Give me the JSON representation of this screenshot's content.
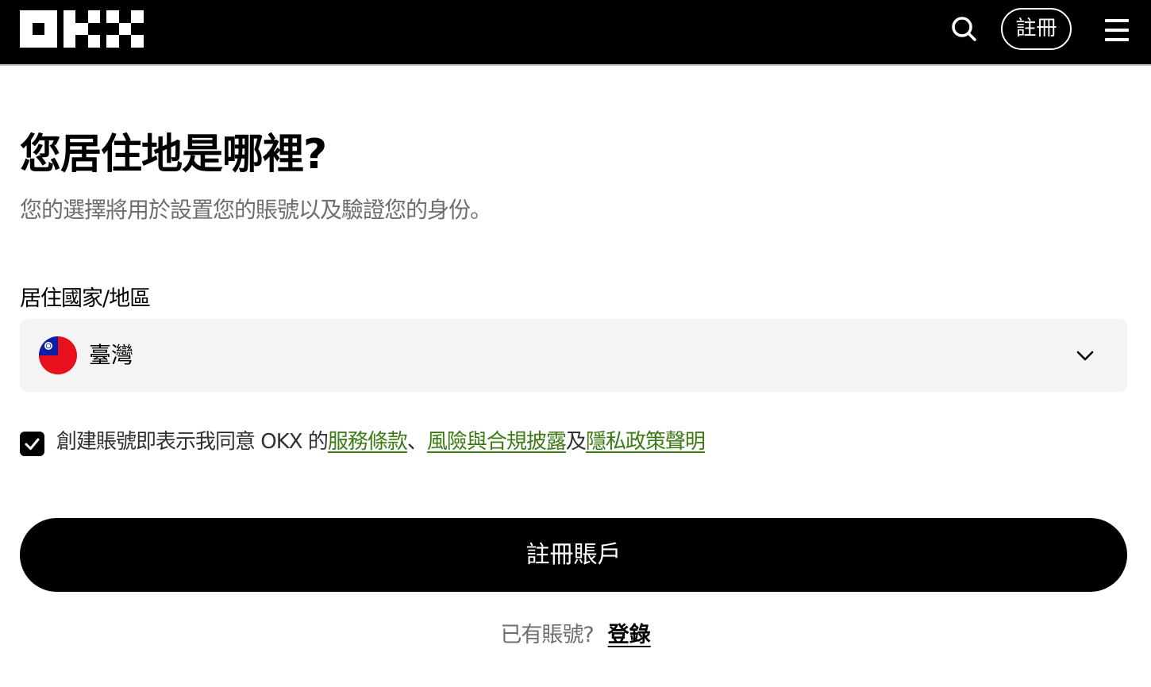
{
  "header": {
    "logo_text": "OKX",
    "search_icon": "search-icon",
    "signup_label": "註冊",
    "menu_icon": "hamburger-menu-icon"
  },
  "main": {
    "title": "您居住地是哪裡?",
    "subtitle": "您的選擇將用於設置您的賬號以及驗證您的身份。",
    "country_field": {
      "label": "居住國家/地區",
      "value": "臺灣",
      "flag_icon": "taiwan-flag-icon",
      "chevron_icon": "chevron-down-icon"
    },
    "agreement": {
      "checked": true,
      "prefix": "創建賬號即表示我同意 OKX 的",
      "terms_link": "服務條款",
      "separator": "、",
      "risk_link": "風險與合規披露",
      "conjunction": "及",
      "privacy_link": "隱私政策聲明"
    },
    "submit_label": "註冊賬戶",
    "login_prompt": "已有賬號?",
    "login_link": "登錄"
  },
  "colors": {
    "header_bg": "#000000",
    "link_green": "#3c7a14",
    "field_bg": "#f4f4f4",
    "muted_text": "#6e6e6e"
  }
}
